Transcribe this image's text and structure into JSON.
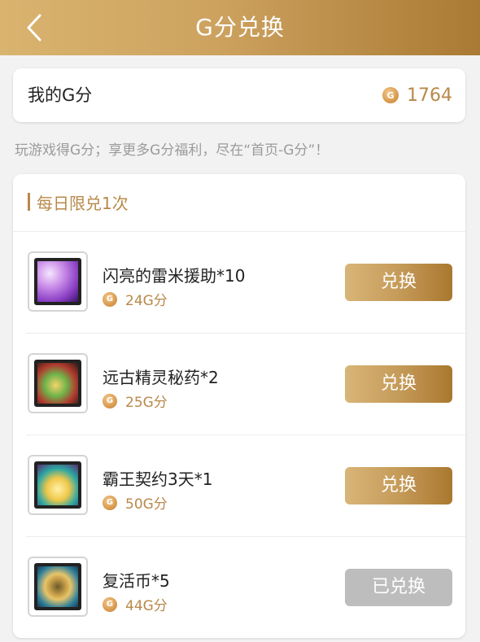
{
  "header": {
    "title": "G分兑换",
    "back_icon": "chevron-left-icon"
  },
  "score": {
    "label": "我的G分",
    "value": "1764",
    "coin_letter": "G"
  },
  "tip": "玩游戏得G分；享更多G分福利，尽在“首页-G分”！",
  "section": {
    "title": "每日限兑1次"
  },
  "items": [
    {
      "name": "闪亮的雷米援助*10",
      "cost": "24G分",
      "button": "兑换",
      "state": "available",
      "icon": "purple-crystal-item-icon"
    },
    {
      "name": "远古精灵秘药*2",
      "cost": "25G分",
      "button": "兑换",
      "state": "available",
      "icon": "elf-potion-item-icon"
    },
    {
      "name": "霸王契约3天*1",
      "cost": "50G分",
      "button": "兑换",
      "state": "available",
      "icon": "overlord-contract-item-icon"
    },
    {
      "name": "复活币*5",
      "cost": "44G分",
      "button": "已兑换",
      "state": "redeemed",
      "icon": "revive-coin-item-icon"
    }
  ],
  "colors": {
    "accent": "#b8894a",
    "header_gradient_start": "#d9b46f",
    "header_gradient_end": "#a97a33",
    "disabled_button": "#bdbdbd"
  }
}
